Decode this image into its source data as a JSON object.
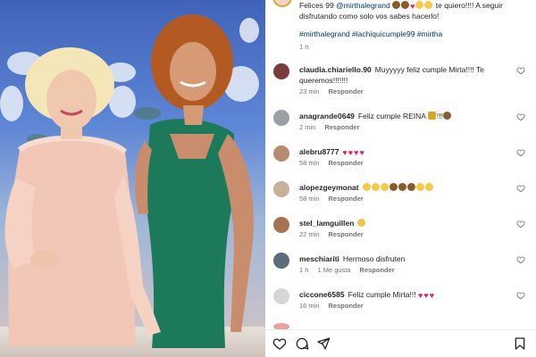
{
  "caption": {
    "line1": "Felices 99 ",
    "mention": "@mirthalegrand",
    "line1_rest": " te quiero!!!! A seguir disfrutando como solo vos sabes hacerlo!",
    "hashtags": "#mirthalegrand #lachiquicumple99 #mirtha",
    "time": "1 h"
  },
  "comments": [
    {
      "user": "claudia.chiariello.90",
      "text": "Muyyyyy feliz cumple Mirta!!!! Te queremos!!!!!!!",
      "time": "23 min",
      "likes": "",
      "reply": "Responder",
      "avatar_color": "#7a3b3b"
    },
    {
      "user": "anagrande0649",
      "text": "Feliz cumple REINA",
      "time": "2 min",
      "likes": "",
      "reply": "Responder",
      "avatar_color": "#9aa0a6"
    },
    {
      "user": "alebru8777",
      "text": "",
      "time": "58 min",
      "likes": "",
      "reply": "Responder",
      "avatar_color": "#b58a6e"
    },
    {
      "user": "alopezgeymonat",
      "text": "",
      "time": "58 min",
      "likes": "",
      "reply": "Responder",
      "avatar_color": "#c8b09a"
    },
    {
      "user": "stel_lamguillen",
      "text": "",
      "time": "22 min",
      "likes": "",
      "reply": "Responder",
      "avatar_color": "#a5744f"
    },
    {
      "user": "meschiariti",
      "text": "Hermoso disfruten",
      "time": "1 h",
      "likes": "1 Me gusta",
      "reply": "Responder",
      "avatar_color": "#5a6b7c"
    },
    {
      "user": "ciccone6585",
      "text": "Feliz cumple Mirta!!!",
      "time": "16 min",
      "likes": "",
      "reply": "Responder",
      "avatar_color": "#d6d6d6"
    }
  ],
  "colors": {
    "link": "#00376b",
    "meta": "#737373",
    "heart": "#e0245e",
    "dress": "#1c7a5a"
  },
  "icons": [
    "heart-icon",
    "comment-icon",
    "share-icon",
    "bookmark-icon"
  ]
}
